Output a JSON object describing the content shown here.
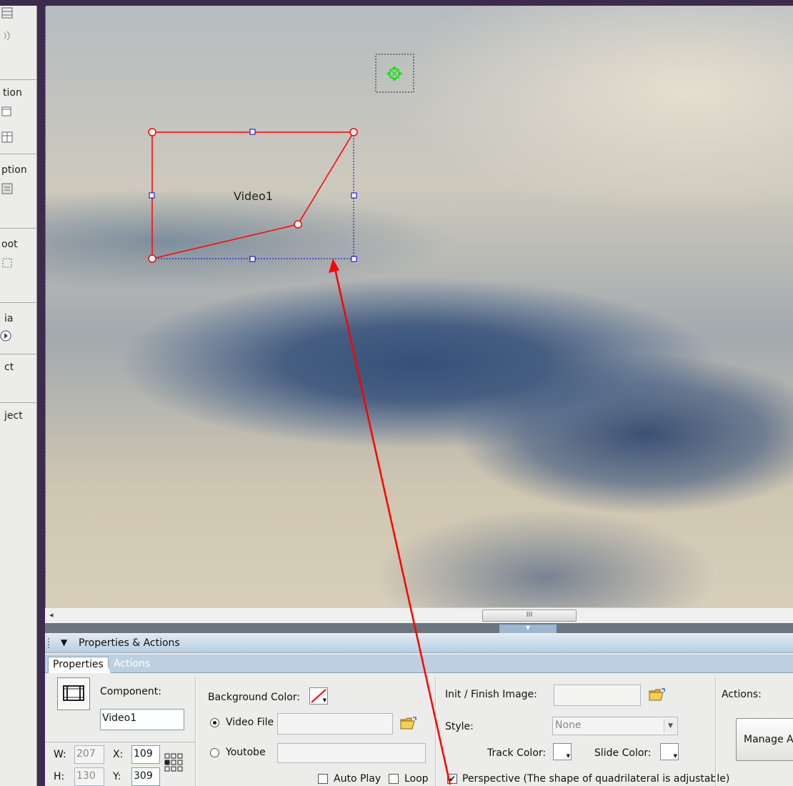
{
  "left_strip": {
    "sections": [
      {
        "label": "",
        "icon": "grid-icon"
      },
      {
        "label": "tion",
        "icon": "window-icon"
      },
      {
        "label": "ption",
        "icon": "list-icon"
      },
      {
        "label": "oot",
        "icon": "selection-icon"
      },
      {
        "label": "ia",
        "icon": "media-icon"
      },
      {
        "label": "ct",
        "icon": ""
      },
      {
        "label": "ject",
        "icon": ""
      }
    ]
  },
  "canvas": {
    "video_label": "Video1"
  },
  "scrollbar": {
    "left_arrow": "◂",
    "thumb_grip": "III"
  },
  "panel": {
    "title": "Properties & Actions",
    "tabs": {
      "properties": "Properties",
      "actions": "Actions"
    },
    "component_label": "Component:",
    "component_name": "Video1",
    "w_label": "W:",
    "w_value": "207",
    "h_label": "H:",
    "h_value": "130",
    "x_label": "X:",
    "x_value": "109",
    "y_label": "Y:",
    "y_value": "309",
    "background_color_label": "Background Color:",
    "video_file_label": "Video File",
    "video_file_value": "",
    "youtube_label": "Youtobe",
    "youtube_value": "",
    "auto_play_label": "Auto Play",
    "auto_play_checked": false,
    "loop_label": "Loop",
    "loop_checked": false,
    "init_finish_label": "Init / Finish Image:",
    "init_finish_value": "",
    "style_label": "Style:",
    "style_value": "None",
    "track_color_label": "Track Color:",
    "slide_color_label": "Slide Color:",
    "perspective_label": "Perspective (The shape of quadrilateral is adjustable)",
    "perspective_checked": true,
    "actions_label": "Actions:",
    "manage_button_label": "Manage A"
  },
  "colors": {
    "selection_red": "#ff0000",
    "handle_blue": "#0000cc",
    "move_handle_green": "#22dd22",
    "panel_header_blue": "#bcd0e2"
  }
}
